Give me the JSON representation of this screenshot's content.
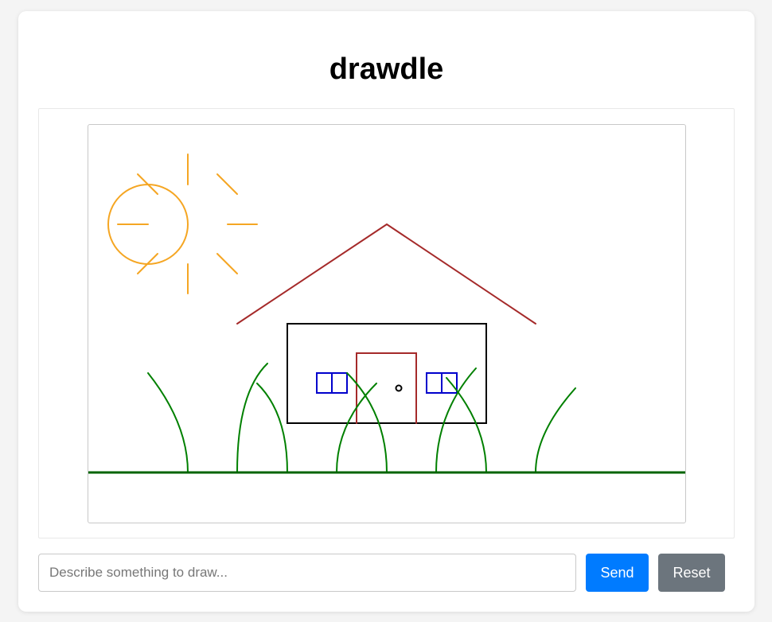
{
  "app": {
    "title": "drawdle"
  },
  "prompt": {
    "placeholder": "Describe something to draw...",
    "value": ""
  },
  "buttons": {
    "send_label": "Send",
    "reset_label": "Reset"
  },
  "colors": {
    "send": "#007bff",
    "reset": "#6c757d",
    "sun": "#f5a623",
    "roof": "#a52a2a",
    "door": "#a52a2a",
    "house": "#000000",
    "windows": "#0000cc",
    "grass": "#008000",
    "ground": "#006400"
  },
  "drawing": {
    "subject": "house with sun and grass"
  }
}
